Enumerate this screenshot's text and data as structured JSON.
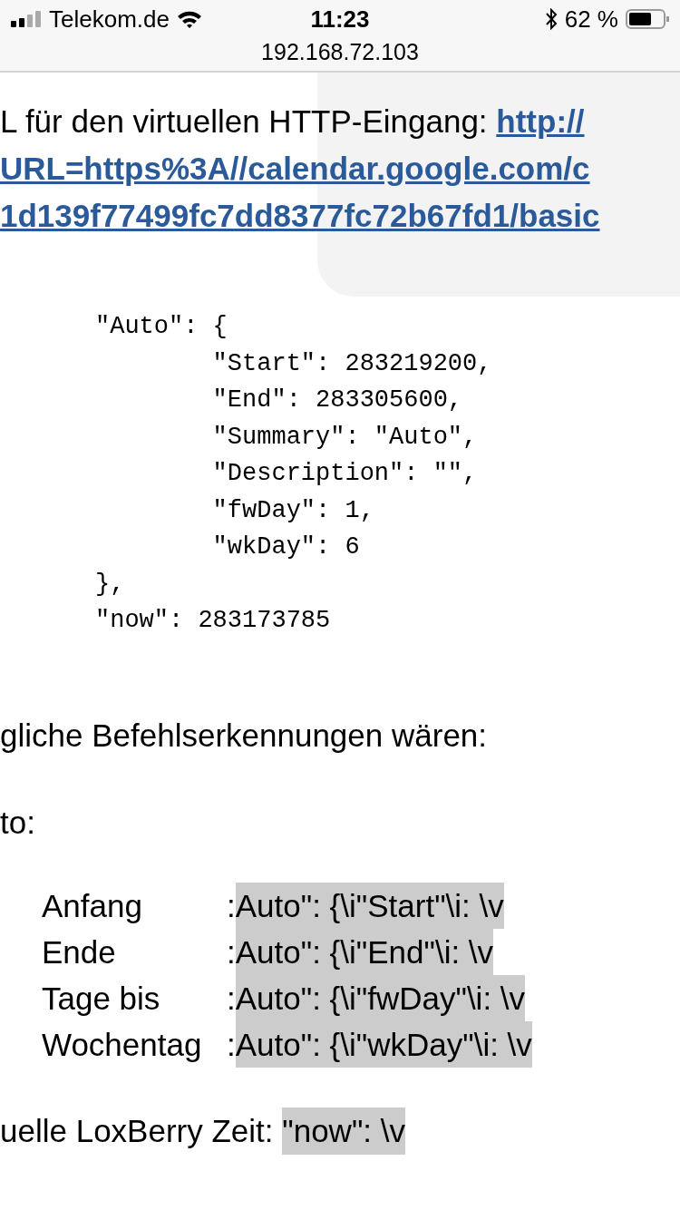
{
  "status_bar": {
    "carrier": "Telekom.de",
    "time": "11:23",
    "battery": "62 %"
  },
  "address_bar": {
    "address": "192.168.72.103"
  },
  "intro": {
    "text": "L für den virtuellen HTTP-Eingang: ",
    "link_lines": [
      "http://",
      "URL=https%3A//calendar.google.com/c",
      "1d139f77499fc7dd8377fc72b67fd1/basic"
    ]
  },
  "code": "\"Auto\": {\n        \"Start\": 283219200,\n        \"End\": 283305600,\n        \"Summary\": \"Auto\",\n        \"Description\": \"\",\n        \"fwDay\": 1,\n        \"wkDay\": 6\n},\n\"now\": 283173785",
  "heading": "gliche Befehlserkennungen wären:",
  "section": "to:",
  "commands": [
    {
      "label": "Anfang",
      "separator": ":",
      "pattern": "Auto\": {\\i\"Start\"\\i: \\v"
    },
    {
      "label": "Ende",
      "separator": ":",
      "pattern": "Auto\": {\\i\"End\"\\i: \\v"
    },
    {
      "label": "Tage bis",
      "separator": ":",
      "pattern": "Auto\": {\\i\"fwDay\"\\i: \\v"
    },
    {
      "label": "Wochentag",
      "separator": ":",
      "pattern": "Auto\": {\\i\"wkDay\"\\i: \\v"
    }
  ],
  "now_line": {
    "label": "uelle LoxBerry Zeit: ",
    "pattern": "\"now\": \\v"
  }
}
